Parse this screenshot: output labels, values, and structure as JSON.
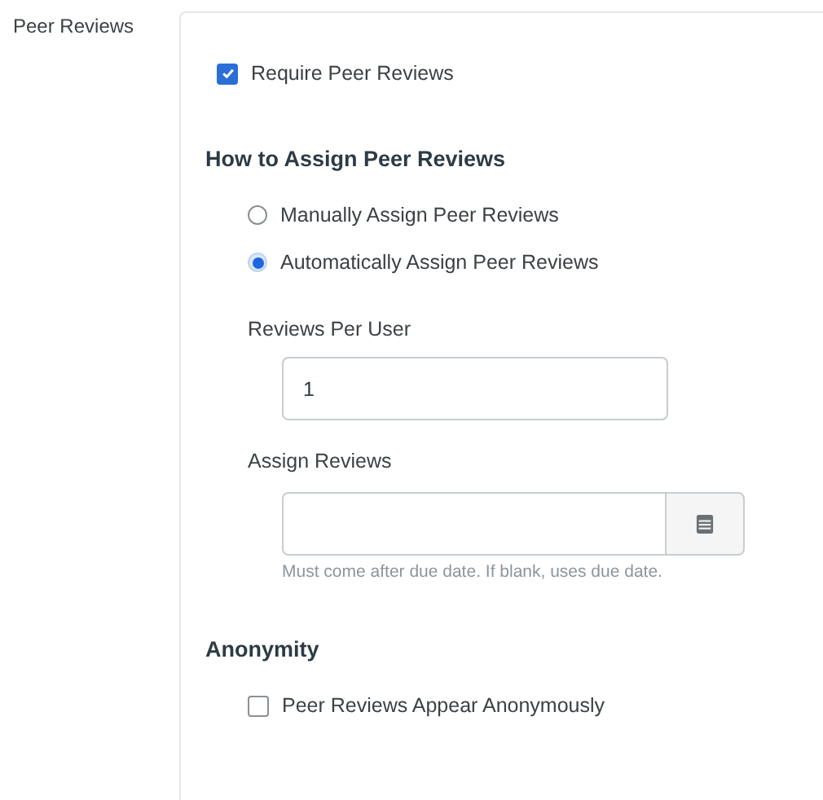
{
  "section_label": "Peer Reviews",
  "require": {
    "label": "Require Peer Reviews",
    "checked": true
  },
  "assign_heading": "How to Assign Peer Reviews",
  "assign_options": [
    {
      "label": "Manually Assign Peer Reviews",
      "selected": false
    },
    {
      "label": "Automatically Assign Peer Reviews",
      "selected": true
    }
  ],
  "reviews_per_user": {
    "label": "Reviews Per User",
    "value": "1"
  },
  "assign_reviews": {
    "label": "Assign Reviews",
    "hint": "Must come after due date. If blank, uses due date."
  },
  "anonymity_heading": "Anonymity",
  "anonymous": {
    "label": "Peer Reviews Appear Anonymously",
    "checked": false
  }
}
